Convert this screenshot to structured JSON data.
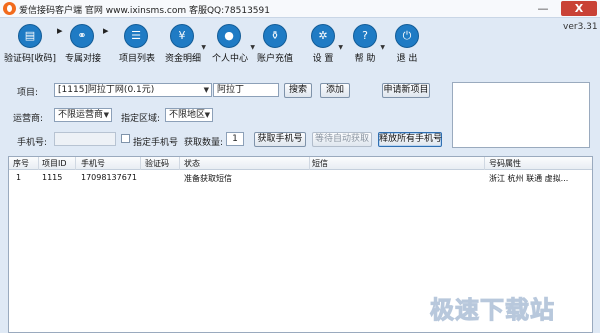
{
  "window": {
    "title": "爱信接码客户端  官网 www.ixinsms.com  客服QQ:78513591",
    "minimize": "—",
    "close": "X",
    "version": "ver3.31"
  },
  "toolbar": {
    "items": [
      {
        "label": "验证码[收码]",
        "icon": "sms-code-icon"
      },
      {
        "label": "专属对接",
        "icon": "link-icon"
      },
      {
        "label": "项目列表",
        "icon": "list-icon"
      },
      {
        "label": "资金明细",
        "icon": "ledger-icon"
      },
      {
        "label": "个人中心",
        "icon": "user-icon"
      },
      {
        "label": "账户充值",
        "icon": "recharge-icon"
      },
      {
        "label": "设  置",
        "icon": "gear-icon"
      },
      {
        "label": "帮  助",
        "icon": "help-icon"
      },
      {
        "label": "退  出",
        "icon": "power-icon"
      }
    ]
  },
  "form": {
    "project_label": "项目:",
    "project_value": "[1115]阿拉丁网(0.1元)",
    "project_search_value": "阿拉丁",
    "search_button": "搜索",
    "add_button": "添加",
    "apply_button": "申请新项目",
    "carrier_label": "运营商:",
    "carrier_value": "不限运营商",
    "region_label": "指定区域:",
    "region_value": "不限地区",
    "phone_label": "手机号:",
    "phone_value": "",
    "specify_phone_label": "指定手机号",
    "get_count_label": "获取数量:",
    "get_count_value": "1",
    "get_phone_button": "获取手机号",
    "wait_auto_button": "等待自动获取",
    "release_all_button": "释放所有手机号"
  },
  "table": {
    "columns": [
      "序号",
      "项目ID",
      "手机号",
      "验证码",
      "状态",
      "短信",
      "号码属性"
    ],
    "rows": [
      {
        "index": "1",
        "project_id": "1115",
        "phone": "17098137671",
        "code": "",
        "status": "准备获取短信",
        "sms": "",
        "attr": "浙江 杭州 联通 虚拟..."
      }
    ]
  },
  "watermark": "极速下载站",
  "colors": {
    "accent": "#1f7bc4",
    "close": "#c94236",
    "background": "#dfe9f5"
  }
}
